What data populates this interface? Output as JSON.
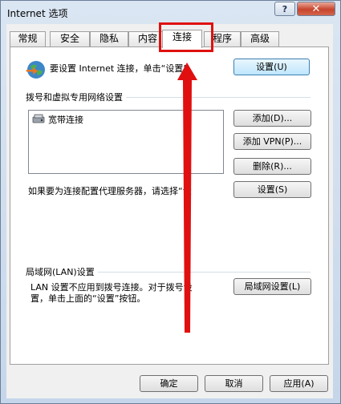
{
  "window": {
    "title": "Internet 选项",
    "help_label": "?",
    "close_label": "✕"
  },
  "tabs": [
    "常规",
    "安全",
    "隐私",
    "内容",
    "连接",
    "程序",
    "高级"
  ],
  "active_tab": "连接",
  "setup": {
    "text": "要设置 Internet 连接，单击“设置”。",
    "button": "设置(U)"
  },
  "dialup": {
    "heading": "拨号和虚拟专用网络设置",
    "items": [
      "宽带连接"
    ],
    "add_button": "添加(D)...",
    "add_vpn_button": "添加 VPN(P)...",
    "remove_button": "删除(R)...",
    "proxy_text": "如果要为连接配置代理服务器，请选择“设",
    "settings_button": "设置(S)"
  },
  "lan": {
    "heading": "局域网(LAN)设置",
    "text_line1": "LAN 设置不应用到拨号连接。对于拨号设",
    "text_line2": "置，单击上面的“设置”按钮。",
    "button": "局域网设置(L)"
  },
  "footer": {
    "ok": "确定",
    "cancel": "取消",
    "apply": "应用(A)"
  },
  "colors": {
    "annotation": "#e01010"
  }
}
